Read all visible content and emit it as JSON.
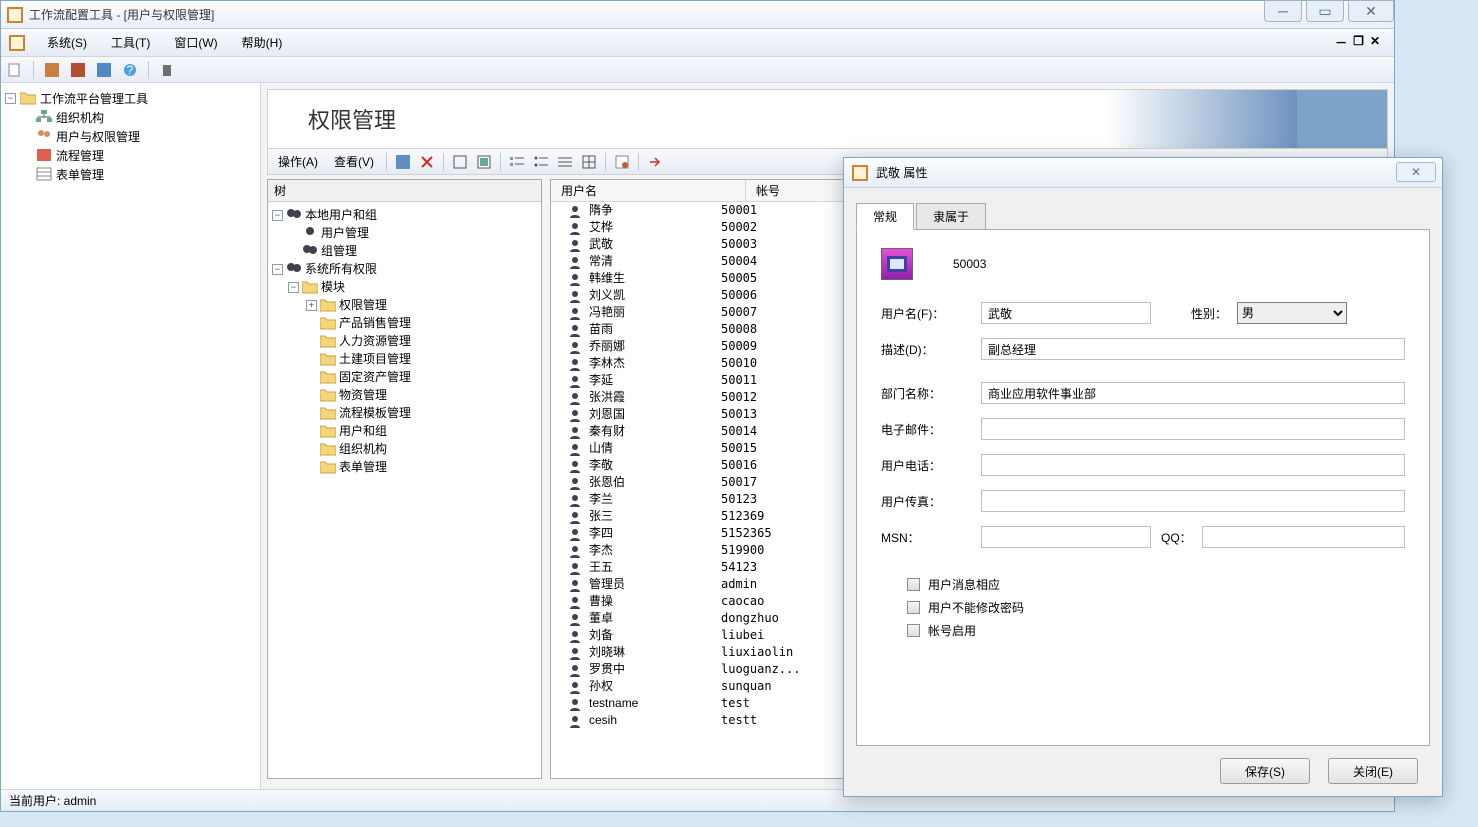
{
  "window": {
    "title": "工作流配置工具 - [用户与权限管理]"
  },
  "menubar": {
    "system": "系统(S)",
    "tools": "工具(T)",
    "window": "窗口(W)",
    "help": "帮助(H)"
  },
  "nav": {
    "root": "工作流平台管理工具",
    "items": [
      "组织机构",
      "用户与权限管理",
      "流程管理",
      "表单管理"
    ]
  },
  "banner": {
    "title": "权限管理"
  },
  "content_toolbar": {
    "op": "操作(A)",
    "view": "查看(V)"
  },
  "tree_panel": {
    "header": "树",
    "root_local": "本地用户和组",
    "user_mgmt": "用户管理",
    "group_mgmt": "组管理",
    "root_perm": "系统所有权限",
    "module": "模块",
    "modules": [
      "权限管理",
      "产品销售管理",
      "人力资源管理",
      "土建项目管理",
      "固定资产管理",
      "物资管理",
      "流程模板管理",
      "用户和组",
      "组织机构",
      "表单管理"
    ]
  },
  "userlist": {
    "col_user": "用户名",
    "col_acct": "帐号",
    "rows": [
      {
        "n": "隋争",
        "a": "50001"
      },
      {
        "n": "艾桦",
        "a": "50002"
      },
      {
        "n": "武敬",
        "a": "50003"
      },
      {
        "n": "常清",
        "a": "50004"
      },
      {
        "n": "韩维生",
        "a": "50005"
      },
      {
        "n": "刘义凯",
        "a": "50006"
      },
      {
        "n": "冯艳丽",
        "a": "50007"
      },
      {
        "n": "苗雨",
        "a": "50008"
      },
      {
        "n": "乔丽娜",
        "a": "50009"
      },
      {
        "n": "李林杰",
        "a": "50010"
      },
      {
        "n": "李延",
        "a": "50011"
      },
      {
        "n": "张洪霞",
        "a": "50012"
      },
      {
        "n": "刘恩国",
        "a": "50013"
      },
      {
        "n": "秦有财",
        "a": "50014"
      },
      {
        "n": "山倩",
        "a": "50015"
      },
      {
        "n": "李敬",
        "a": "50016"
      },
      {
        "n": "张恩伯",
        "a": "50017"
      },
      {
        "n": "李兰",
        "a": "50123"
      },
      {
        "n": "张三",
        "a": "512369"
      },
      {
        "n": "李四",
        "a": "5152365"
      },
      {
        "n": "李杰",
        "a": "519900"
      },
      {
        "n": "王五",
        "a": "54123"
      },
      {
        "n": "管理员",
        "a": "admin"
      },
      {
        "n": "曹操",
        "a": "caocao"
      },
      {
        "n": "董卓",
        "a": "dongzhuo"
      },
      {
        "n": "刘备",
        "a": "liubei"
      },
      {
        "n": "刘晓琳",
        "a": "liuxiaolin"
      },
      {
        "n": "罗贯中",
        "a": "luoguanz..."
      },
      {
        "n": "孙权",
        "a": "sunquan"
      },
      {
        "n": "testname",
        "a": "test"
      },
      {
        "n": "cesih",
        "a": "testt"
      }
    ]
  },
  "dialog": {
    "title": "武敬 属性",
    "tab_general": "常规",
    "tab_member": "隶属于",
    "account": "50003",
    "lbl_username": "用户名(F)：",
    "val_username": "武敬",
    "lbl_gender": "性别：",
    "val_gender": "男",
    "lbl_desc": "描述(D)：",
    "val_desc": "副总经理",
    "lbl_dept": "部门名称：",
    "val_dept": "商业应用软件事业部",
    "lbl_email": "电子邮件：",
    "lbl_phone": "用户电话：",
    "lbl_fax": "用户传真：",
    "lbl_msn": "MSN：",
    "lbl_qq": "QQ：",
    "chk_msg": "用户消息相应",
    "chk_pwd": "用户不能修改密码",
    "chk_enable": "帐号启用",
    "btn_save": "保存(S)",
    "btn_close": "关闭(E)"
  },
  "status": {
    "current_user": "当前用户: admin"
  }
}
